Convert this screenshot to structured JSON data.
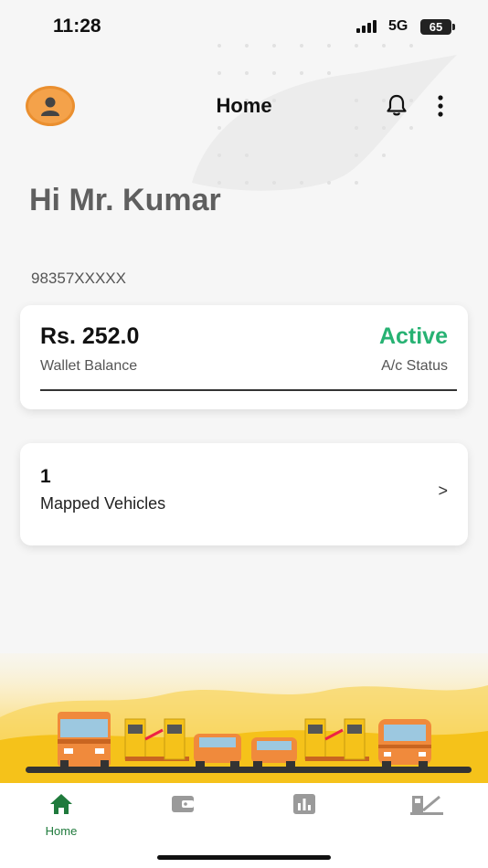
{
  "status_bar": {
    "time": "11:28",
    "network": "5G",
    "battery": "65"
  },
  "header": {
    "title": "Home"
  },
  "greeting": "Hi Mr. Kumar",
  "phone": "98357XXXXX",
  "wallet": {
    "balance": "Rs. 252.0",
    "balance_label": "Wallet Balance",
    "status": "Active",
    "status_label": "A/c Status"
  },
  "vehicles": {
    "count": "1",
    "label": "Mapped Vehicles",
    "arrow": ">"
  },
  "tabs": [
    {
      "label": "Home",
      "icon": "home-icon",
      "active": true
    },
    {
      "label": "",
      "icon": "wallet-icon",
      "active": false
    },
    {
      "label": "",
      "icon": "stats-icon",
      "active": false
    },
    {
      "label": "",
      "icon": "toll-icon",
      "active": false
    }
  ],
  "colors": {
    "accent": "#27b273",
    "avatar": "#f4a24a",
    "tab_active": "#1f7a3c",
    "tab_inactive": "#9a9a9a",
    "illustration_yellow": "#f5c21a"
  }
}
